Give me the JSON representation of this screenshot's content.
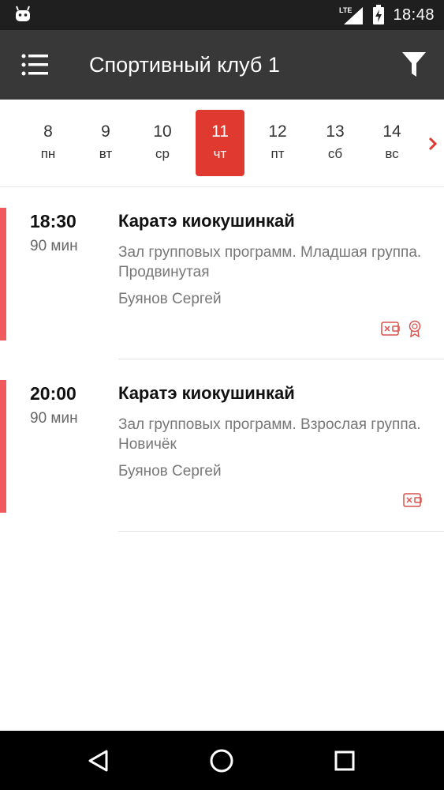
{
  "status_bar": {
    "network_label": "LTE",
    "time": "18:48"
  },
  "app_bar": {
    "title": "Спортивный клуб 1"
  },
  "date_strip": {
    "days": [
      {
        "num": "8",
        "weekday": "пн"
      },
      {
        "num": "9",
        "weekday": "вт"
      },
      {
        "num": "10",
        "weekday": "ср"
      },
      {
        "num": "11",
        "weekday": "чт"
      },
      {
        "num": "12",
        "weekday": "пт"
      },
      {
        "num": "13",
        "weekday": "сб"
      },
      {
        "num": "14",
        "weekday": "вс"
      }
    ],
    "selected_index": 3
  },
  "sessions": [
    {
      "time": "18:30",
      "duration": "90 мин",
      "name": "Каратэ киокушинкай",
      "hall": "Зал групповых программ. Младшая группа. Продвинутая",
      "coach": "Буянов Сергей",
      "icons": [
        "wallet-cancel-icon",
        "award-icon"
      ]
    },
    {
      "time": "20:00",
      "duration": "90 мин",
      "name": "Каратэ киокушинкай",
      "hall": "Зал групповых программ. Взрослая группа. Новичёк",
      "coach": "Буянов Сергей",
      "icons": [
        "wallet-cancel-icon"
      ]
    }
  ],
  "colors": {
    "accent": "#e0392f",
    "session_bar": "#f05a5c",
    "app_bar": "#383838",
    "status_bar": "#1f1f1f"
  }
}
